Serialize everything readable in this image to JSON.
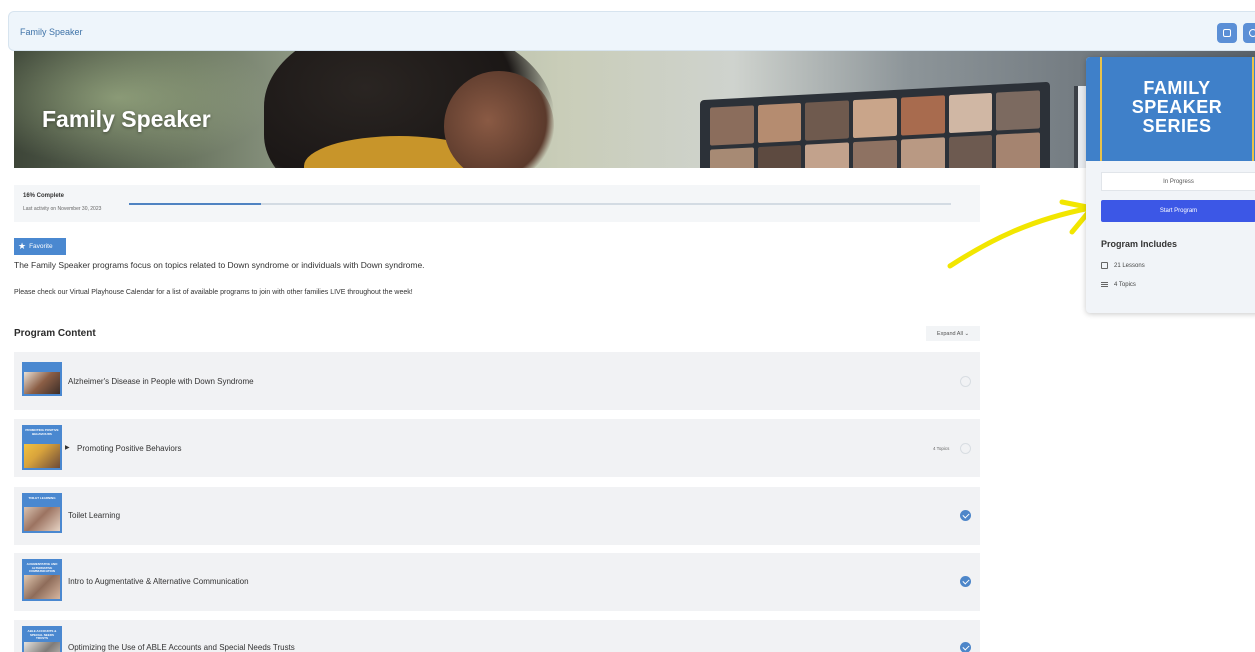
{
  "topbar": {
    "breadcrumb": "Family Speaker"
  },
  "hero": {
    "title": "Family Speaker"
  },
  "progress": {
    "percent_label": "16% Complete",
    "percent": 16,
    "last_activity": "Last activity on November 30, 2023"
  },
  "favorite": {
    "label": "Favorite"
  },
  "description": {
    "line1": "The Family Speaker programs focus on topics related to Down syndrome or individuals with Down syndrome.",
    "line2": "Please check our Virtual Playhouse Calendar for a list of available programs to join with other families LIVE throughout the week!"
  },
  "program_content": {
    "title": "Program Content",
    "expand_label": "Expand All ⌄",
    "lessons": [
      {
        "title": "Alzheimer's Disease in People with Down Syndrome",
        "thumb_caption": "",
        "status": "incomplete",
        "topics": "",
        "expandable": false
      },
      {
        "title": "Promoting Positive Behaviors",
        "thumb_caption": "PROMOTING POSITIVE BEHAVIOURS",
        "status": "incomplete",
        "topics": "4 Topics",
        "expandable": true
      },
      {
        "title": "Toilet Learning",
        "thumb_caption": "TOILET LEARNING",
        "status": "complete",
        "topics": "",
        "expandable": false
      },
      {
        "title": "Intro to Augmentative & Alternative Communication",
        "thumb_caption": "AUGMENTATIVE AND ALTERNATIVE COMMUNICATION",
        "status": "complete",
        "topics": "",
        "expandable": false
      },
      {
        "title": "Optimizing the Use of ABLE Accounts and Special Needs Trusts",
        "thumb_caption": "ABLE ACCOUNTS & SPECIAL NEEDS TRUSTS",
        "status": "complete",
        "topics": "",
        "expandable": false
      }
    ]
  },
  "card": {
    "image_line1": "FAMILY",
    "image_line2": "SPEAKER",
    "image_line3": "SERIES",
    "status": "In Progress",
    "start_label": "Start Program",
    "includes_title": "Program Includes",
    "lessons_count": "21 Lessons",
    "topics_count": "4 Topics"
  },
  "colors": {
    "accent": "#4a88d0",
    "start_button": "#3c57e6",
    "check": "#4d86c9",
    "arrow": "#f2e600"
  },
  "icons": {
    "topbar_button_1": "square-icon",
    "topbar_button_2": "search-icon",
    "favorite": "star-icon",
    "lessons": "book-icon",
    "topics": "list-icon"
  }
}
